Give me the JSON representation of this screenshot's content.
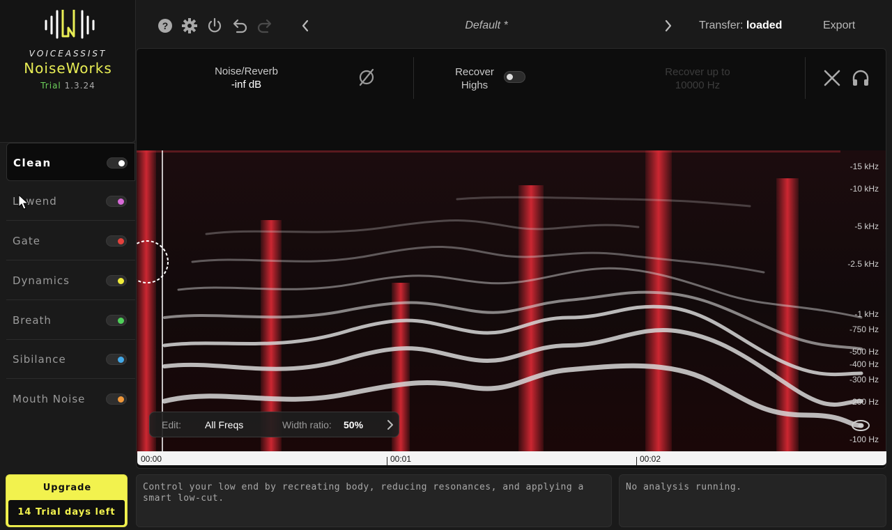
{
  "brand": {
    "sup": "VOICEASSIST",
    "name": "NoiseWorks",
    "trial_tag": "Trial",
    "version": "1.3.24"
  },
  "modules": [
    {
      "label": "Clean",
      "dot_color": "#ffffff",
      "active": true
    },
    {
      "label": "Lowend",
      "dot_color": "#d86ad8"
    },
    {
      "label": "Gate",
      "dot_color": "#e5413c"
    },
    {
      "label": "Dynamics",
      "dot_color": "#f0ec3a"
    },
    {
      "label": "Breath",
      "dot_color": "#4fd05a"
    },
    {
      "label": "Sibilance",
      "dot_color": "#44a9e8"
    },
    {
      "label": "Mouth Noise",
      "dot_color": "#f0983a"
    }
  ],
  "upgrade": {
    "label": "Upgrade",
    "trial_days": "14 Trial days left"
  },
  "topbar": {
    "icons": [
      "help-icon",
      "settings-icon",
      "power-icon",
      "undo-icon",
      "redo-icon"
    ],
    "preset_name": "Default *",
    "transfer_label": "Transfer:",
    "transfer_status": "loaded",
    "export_label": "Export"
  },
  "controls": {
    "noise_title": "Noise/Reverb",
    "noise_value": "-inf dB",
    "recover_label_1": "Recover",
    "recover_label_2": "Highs",
    "recover_up_1": "Recover up to",
    "recover_up_2": "10000 Hz"
  },
  "spectrogram": {
    "freq_labels": [
      "-15 kHz",
      "-10 kHz",
      "-5 kHz",
      "-2.5 kHz",
      "-1 kHz",
      "-750 Hz",
      "-500 Hz",
      "-400 Hz",
      "-300 Hz",
      "-200 Hz",
      "-100 Hz"
    ]
  },
  "edit": {
    "edit_label": "Edit:",
    "edit_value": "All Freqs",
    "width_label": "Width ratio:",
    "width_value": "50%"
  },
  "timeline": {
    "ticks": [
      "00:00",
      "00:01",
      "00:02"
    ]
  },
  "status": {
    "description": "Control your low end by recreating body, reducing resonances, and applying a smart low-cut.",
    "analysis": "No analysis running."
  },
  "colors": {
    "accent": "#f2f24e",
    "trial_green": "#6ed35c",
    "spectro_red": "#e02a36"
  }
}
